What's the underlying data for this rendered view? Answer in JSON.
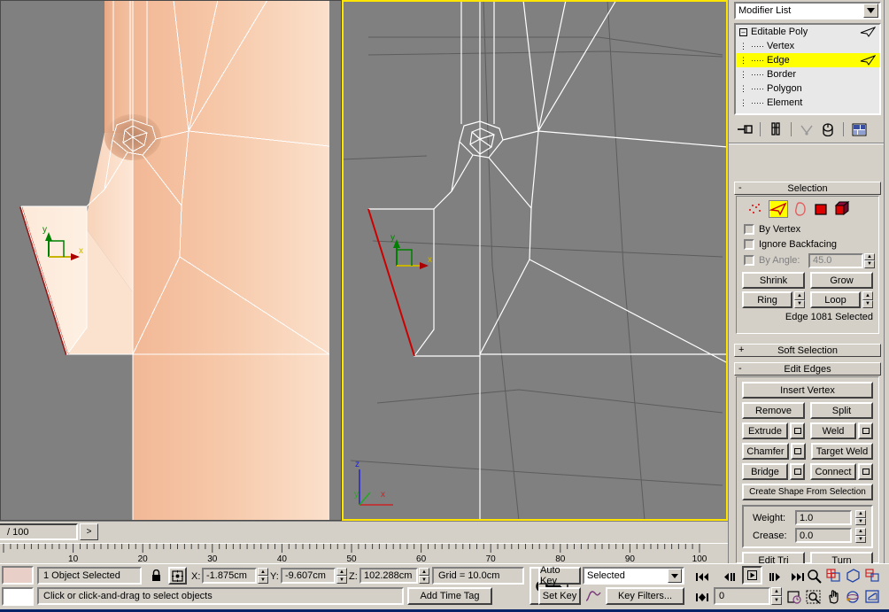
{
  "viewports": {
    "left": {
      "name": "left-viewport",
      "shading": "smooth-shaded",
      "active": false,
      "bg": "#808080",
      "gizmo": {
        "y_label": "y",
        "x_label": "x"
      }
    },
    "right": {
      "name": "right-viewport",
      "shading": "wireframe",
      "active": true,
      "bg": "#808080",
      "border_color": "#ffe500",
      "gizmo": {
        "y_label": "y",
        "x_label": "x"
      },
      "world_axis": {
        "z_label": "z",
        "y_label": "y",
        "x_label": "x"
      }
    }
  },
  "timebar": {
    "time_field": "/ 100",
    "next_button": ">",
    "ruler_start": 0,
    "ruler_end": 100,
    "ruler_labels": [
      10,
      20,
      30,
      40,
      50,
      60,
      70,
      80,
      90,
      100
    ]
  },
  "command_panel": {
    "modifier_list": {
      "label": "Modifier List",
      "arrow": "chevron-down-icon"
    },
    "stack": {
      "items": [
        {
          "label": "Editable Poly",
          "level": 0,
          "selected": false,
          "has_toggle": true,
          "toggle": "-",
          "light": true
        },
        {
          "label": "Vertex",
          "level": 1,
          "selected": false,
          "light": false
        },
        {
          "label": "Edge",
          "level": 1,
          "selected": true,
          "light": true
        },
        {
          "label": "Border",
          "level": 1,
          "selected": false,
          "light": false
        },
        {
          "label": "Polygon",
          "level": 1,
          "selected": false,
          "light": false
        },
        {
          "label": "Element",
          "level": 1,
          "selected": false,
          "light": false
        }
      ]
    },
    "stack_tools": [
      {
        "name": "pin-stack-icon"
      },
      {
        "name": "show-end-result-icon"
      },
      {
        "name": "make-unique-icon"
      },
      {
        "name": "remove-modifier-icon"
      },
      {
        "name": "configure-modifier-sets-icon"
      }
    ],
    "selection_rollout": {
      "title": "Selection",
      "collapse": "-",
      "sub_object_buttons": [
        {
          "name": "vertex-subobject-icon",
          "active": false
        },
        {
          "name": "edge-subobject-icon",
          "active": true
        },
        {
          "name": "border-subobject-icon",
          "active": false
        },
        {
          "name": "polygon-subobject-icon",
          "active": false
        },
        {
          "name": "element-subobject-icon",
          "active": false
        }
      ],
      "by_vertex": {
        "label": "By Vertex",
        "checked": false,
        "enabled": true
      },
      "ignore_backfacing": {
        "label": "Ignore Backfacing",
        "checked": false,
        "enabled": true
      },
      "by_angle": {
        "label": "By Angle:",
        "checked": false,
        "enabled": false,
        "value": "45.0"
      },
      "shrink": "Shrink",
      "grow": "Grow",
      "ring": "Ring",
      "loop": "Loop",
      "status": "Edge 1081 Selected"
    },
    "soft_selection_rollout": {
      "title": "Soft Selection",
      "collapse": "+"
    },
    "edit_edges_rollout": {
      "title": "Edit Edges",
      "collapse": "-",
      "insert_vertex": "Insert Vertex",
      "remove": "Remove",
      "split": "Split",
      "extrude": "Extrude",
      "weld": "Weld",
      "chamfer": "Chamfer",
      "target_weld": "Target Weld",
      "bridge": "Bridge",
      "connect": "Connect",
      "create_shape": "Create Shape From Selection",
      "weight_label": "Weight:",
      "weight_value": "1.0",
      "crease_label": "Crease:",
      "crease_value": "0.0",
      "edit_tri": "Edit Tri",
      "turn": "Turn"
    }
  },
  "status_bar": {
    "selection_text": "1 Object Selected",
    "lock_icon": "lock-selection-icon",
    "absolute_mode_icon": "absolute-relative-transform-icon",
    "x_label": "X:",
    "x_value": "-1.875cm",
    "y_label": "Y:",
    "y_value": "-9.607cm",
    "z_label": "Z:",
    "z_value": "102.288cm",
    "grid_text": "Grid = 10.0cm",
    "prompt_text": "Click or click-and-drag to select objects",
    "add_time_tag": "Add Time Tag",
    "key_mode_icon": "key-mode-toggle-icon",
    "auto_key": "Auto Key",
    "set_key": "Set Key",
    "filter_value": "Selected",
    "curve_editor_icon": "parameter-curve-icon",
    "key_filters": "Key Filters...",
    "frame_value": "0",
    "transport": [
      {
        "name": "go-to-start-icon"
      },
      {
        "name": "previous-frame-icon"
      },
      {
        "name": "play-animation-icon"
      },
      {
        "name": "next-frame-icon"
      },
      {
        "name": "go-to-end-icon"
      },
      {
        "name": "key-mode-icon"
      }
    ],
    "nav_icons": [
      {
        "name": "zoom-icon"
      },
      {
        "name": "zoom-all-icon"
      },
      {
        "name": "zoom-extents-icon"
      },
      {
        "name": "zoom-extents-all-icon"
      },
      {
        "name": "time-configuration-icon"
      },
      {
        "name": "region-zoom-icon"
      },
      {
        "name": "pan-view-icon"
      },
      {
        "name": "arc-rotate-icon"
      },
      {
        "name": "maximize-viewport-icon"
      }
    ]
  }
}
